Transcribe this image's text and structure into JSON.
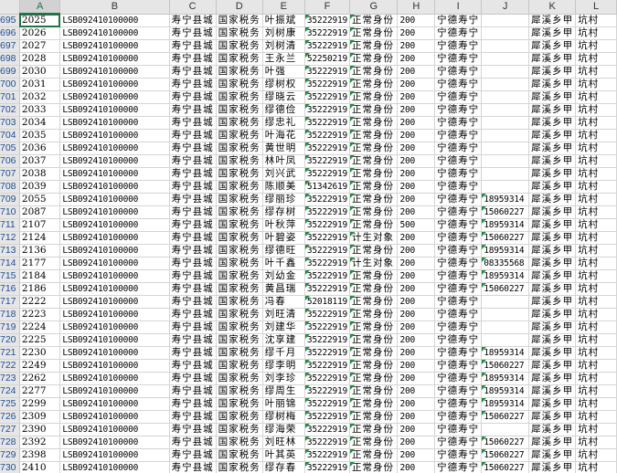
{
  "columns": [
    "A",
    "B",
    "C",
    "D",
    "E",
    "F",
    "G",
    "H",
    "I",
    "J",
    "K",
    "L"
  ],
  "rows": [
    {
      "n": "695",
      "a": "2025",
      "b": "LSB092410100000",
      "c": "寿宁县城",
      "d": "国家税务",
      "e": "叶振斌",
      "f": "35222919",
      "g": "正常身份",
      "h": "200",
      "i": "宁德寿宁",
      "j": "",
      "k": "犀溪乡甲",
      "l": "坑村"
    },
    {
      "n": "696",
      "a": "2026",
      "b": "LSB092410100000",
      "c": "寿宁县城",
      "d": "国家税务",
      "e": "刘树康",
      "f": "35222919",
      "g": "正常身份",
      "h": "200",
      "i": "宁德寿宁",
      "j": "",
      "k": "犀溪乡甲",
      "l": "坑村"
    },
    {
      "n": "697",
      "a": "2027",
      "b": "LSB092410100000",
      "c": "寿宁县城",
      "d": "国家税务",
      "e": "刘树清",
      "f": "35222919",
      "g": "正常身份",
      "h": "200",
      "i": "宁德寿宁",
      "j": "",
      "k": "犀溪乡甲",
      "l": "坑村"
    },
    {
      "n": "698",
      "a": "2028",
      "b": "LSB092410100000",
      "c": "寿宁县城",
      "d": "国家税务",
      "e": "王永兰",
      "f": "52250219",
      "g": "正常身份",
      "h": "200",
      "i": "宁德寿宁",
      "j": "",
      "k": "犀溪乡甲",
      "l": "坑村"
    },
    {
      "n": "699",
      "a": "2030",
      "b": "LSB092410100000",
      "c": "寿宁县城",
      "d": "国家税务",
      "e": "叶强",
      "f": "35222919",
      "g": "正常身份",
      "h": "200",
      "i": "宁德寿宁",
      "j": "",
      "k": "犀溪乡甲",
      "l": "坑村"
    },
    {
      "n": "700",
      "a": "2031",
      "b": "LSB092410100000",
      "c": "寿宁县城",
      "d": "国家税务",
      "e": "缪树权",
      "f": "35222919",
      "g": "正常身份",
      "h": "200",
      "i": "宁德寿宁",
      "j": "",
      "k": "犀溪乡甲",
      "l": "坑村"
    },
    {
      "n": "701",
      "a": "2032",
      "b": "LSB092410100000",
      "c": "寿宁县城",
      "d": "国家税务",
      "e": "缪晓云",
      "f": "35222919",
      "g": "正常身份",
      "h": "200",
      "i": "宁德寿宁",
      "j": "",
      "k": "犀溪乡甲",
      "l": "坑村"
    },
    {
      "n": "702",
      "a": "2033",
      "b": "LSB092410100000",
      "c": "寿宁县城",
      "d": "国家税务",
      "e": "缪德俭",
      "f": "35222919",
      "g": "正常身份",
      "h": "200",
      "i": "宁德寿宁",
      "j": "",
      "k": "犀溪乡甲",
      "l": "坑村"
    },
    {
      "n": "703",
      "a": "2034",
      "b": "LSB092410100000",
      "c": "寿宁县城",
      "d": "国家税务",
      "e": "缪忠礼",
      "f": "35222919",
      "g": "正常身份",
      "h": "200",
      "i": "宁德寿宁",
      "j": "",
      "k": "犀溪乡甲",
      "l": "坑村"
    },
    {
      "n": "704",
      "a": "2035",
      "b": "LSB092410100000",
      "c": "寿宁县城",
      "d": "国家税务",
      "e": "叶海花",
      "f": "35222919",
      "g": "正常身份",
      "h": "200",
      "i": "宁德寿宁",
      "j": "",
      "k": "犀溪乡甲",
      "l": "坑村"
    },
    {
      "n": "705",
      "a": "2036",
      "b": "LSB092410100000",
      "c": "寿宁县城",
      "d": "国家税务",
      "e": "黄世明",
      "f": "35222919",
      "g": "正常身份",
      "h": "200",
      "i": "宁德寿宁",
      "j": "",
      "k": "犀溪乡甲",
      "l": "坑村"
    },
    {
      "n": "706",
      "a": "2037",
      "b": "LSB092410100000",
      "c": "寿宁县城",
      "d": "国家税务",
      "e": "林叶凤",
      "f": "35222919",
      "g": "正常身份",
      "h": "200",
      "i": "宁德寿宁",
      "j": "",
      "k": "犀溪乡甲",
      "l": "坑村"
    },
    {
      "n": "707",
      "a": "2038",
      "b": "LSB092410100000",
      "c": "寿宁县城",
      "d": "国家税务",
      "e": "刘兴武",
      "f": "35222919",
      "g": "正常身份",
      "h": "200",
      "i": "宁德寿宁",
      "j": "",
      "k": "犀溪乡甲",
      "l": "坑村"
    },
    {
      "n": "708",
      "a": "2039",
      "b": "LSB092410100000",
      "c": "寿宁县城",
      "d": "国家税务",
      "e": "陈顺美",
      "f": "51342619",
      "g": "正常身份",
      "h": "200",
      "i": "宁德寿宁",
      "j": "",
      "k": "犀溪乡甲",
      "l": "坑村"
    },
    {
      "n": "709",
      "a": "2055",
      "b": "LSB092410100000",
      "c": "寿宁县城",
      "d": "国家税务",
      "e": "缪丽珍",
      "f": "35222919",
      "g": "正常身份",
      "h": "200",
      "i": "宁德寿宁",
      "j": "18959314",
      "k": "犀溪乡甲",
      "l": "坑村"
    },
    {
      "n": "710",
      "a": "2087",
      "b": "LSB092410100000",
      "c": "寿宁县城",
      "d": "国家税务",
      "e": "缪存树",
      "f": "35222919",
      "g": "正常身份",
      "h": "200",
      "i": "宁德寿宁",
      "j": "15060227",
      "k": "犀溪乡甲",
      "l": "坑村"
    },
    {
      "n": "711",
      "a": "2107",
      "b": "LSB092410100000",
      "c": "寿宁县城",
      "d": "国家税务",
      "e": "叶秋萍",
      "f": "35222919",
      "g": "正常身份",
      "h": "500",
      "i": "宁德寿宁",
      "j": "18959314",
      "k": "犀溪乡甲",
      "l": "坑村"
    },
    {
      "n": "712",
      "a": "2124",
      "b": "LSB092410100000",
      "c": "寿宁县城",
      "d": "国家税务",
      "e": "叶碧姿",
      "f": "35222919",
      "g": "计生对象",
      "h": "200",
      "i": "宁德寿宁",
      "j": "15060227",
      "k": "犀溪乡甲",
      "l": "坑村"
    },
    {
      "n": "713",
      "a": "2136",
      "b": "LSB092410100000",
      "c": "寿宁县城",
      "d": "国家税务",
      "e": "缪德旺",
      "f": "35222919",
      "g": "正常身份",
      "h": "200",
      "i": "宁德寿宁",
      "j": "18959314",
      "k": "犀溪乡甲",
      "l": "坑村"
    },
    {
      "n": "714",
      "a": "2177",
      "b": "LSB092410100000",
      "c": "寿宁县城",
      "d": "国家税务",
      "e": "叶千鑫",
      "f": "35222919",
      "g": "计生对象",
      "h": "200",
      "i": "宁德寿宁",
      "j": "08335568",
      "k": "犀溪乡甲",
      "l": "坑村"
    },
    {
      "n": "715",
      "a": "2184",
      "b": "LSB092410100000",
      "c": "寿宁县城",
      "d": "国家税务",
      "e": "刘幼金",
      "f": "35222919",
      "g": "正常身份",
      "h": "200",
      "i": "宁德寿宁",
      "j": "18959314",
      "k": "犀溪乡甲",
      "l": "坑村"
    },
    {
      "n": "716",
      "a": "2186",
      "b": "LSB092410100000",
      "c": "寿宁县城",
      "d": "国家税务",
      "e": "黄昌瑞",
      "f": "35222919",
      "g": "正常身份",
      "h": "200",
      "i": "宁德寿宁",
      "j": "15060227",
      "k": "犀溪乡甲",
      "l": "坑村"
    },
    {
      "n": "717",
      "a": "2222",
      "b": "LSB092410100000",
      "c": "寿宁县城",
      "d": "国家税务",
      "e": "冯春",
      "f": "52018119",
      "g": "正常身份",
      "h": "200",
      "i": "宁德寿宁",
      "j": "",
      "k": "犀溪乡甲",
      "l": "坑村"
    },
    {
      "n": "718",
      "a": "2223",
      "b": "LSB092410100000",
      "c": "寿宁县城",
      "d": "国家税务",
      "e": "刘旺清",
      "f": "35222919",
      "g": "正常身份",
      "h": "200",
      "i": "宁德寿宁",
      "j": "",
      "k": "犀溪乡甲",
      "l": "坑村"
    },
    {
      "n": "719",
      "a": "2224",
      "b": "LSB092410100000",
      "c": "寿宁县城",
      "d": "国家税务",
      "e": "刘建华",
      "f": "35222919",
      "g": "正常身份",
      "h": "200",
      "i": "宁德寿宁",
      "j": "",
      "k": "犀溪乡甲",
      "l": "坑村"
    },
    {
      "n": "720",
      "a": "2225",
      "b": "LSB092410100000",
      "c": "寿宁县城",
      "d": "国家税务",
      "e": "沈享建",
      "f": "35222919",
      "g": "正常身份",
      "h": "200",
      "i": "宁德寿宁",
      "j": "",
      "k": "犀溪乡甲",
      "l": "坑村"
    },
    {
      "n": "721",
      "a": "2230",
      "b": "LSB092410100000",
      "c": "寿宁县城",
      "d": "国家税务",
      "e": "缪千月",
      "f": "35222919",
      "g": "正常身份",
      "h": "200",
      "i": "宁德寿宁",
      "j": "18959314",
      "k": "犀溪乡甲",
      "l": "坑村"
    },
    {
      "n": "722",
      "a": "2249",
      "b": "LSB092410100000",
      "c": "寿宁县城",
      "d": "国家税务",
      "e": "缪李明",
      "f": "35222919",
      "g": "正常身份",
      "h": "200",
      "i": "宁德寿宁",
      "j": "15060227",
      "k": "犀溪乡甲",
      "l": "坑村"
    },
    {
      "n": "723",
      "a": "2262",
      "b": "LSB092410100000",
      "c": "寿宁县城",
      "d": "国家税务",
      "e": "刘李珍",
      "f": "35222919",
      "g": "正常身份",
      "h": "200",
      "i": "宁德寿宁",
      "j": "18959314",
      "k": "犀溪乡甲",
      "l": "坑村"
    },
    {
      "n": "724",
      "a": "2277",
      "b": "LSB092410100000",
      "c": "寿宁县城",
      "d": "国家税务",
      "e": "缪周生",
      "f": "35222919",
      "g": "正常身份",
      "h": "200",
      "i": "宁德寿宁",
      "j": "18959314",
      "k": "犀溪乡甲",
      "l": "坑村"
    },
    {
      "n": "725",
      "a": "2299",
      "b": "LSB092410100000",
      "c": "寿宁县城",
      "d": "国家税务",
      "e": "叶丽锦",
      "f": "35222919",
      "g": "正常身份",
      "h": "200",
      "i": "宁德寿宁",
      "j": "18959314",
      "k": "犀溪乡甲",
      "l": "坑村"
    },
    {
      "n": "726",
      "a": "2309",
      "b": "LSB092410100000",
      "c": "寿宁县城",
      "d": "国家税务",
      "e": "缪树梅",
      "f": "35222919",
      "g": "正常身份",
      "h": "200",
      "i": "宁德寿宁",
      "j": "15060227",
      "k": "犀溪乡甲",
      "l": "坑村"
    },
    {
      "n": "727",
      "a": "2390",
      "b": "LSB092410100000",
      "c": "寿宁县城",
      "d": "国家税务",
      "e": "缪海荣",
      "f": "35222919",
      "g": "正常身份",
      "h": "200",
      "i": "宁德寿宁",
      "j": "",
      "k": "犀溪乡甲",
      "l": "坑村"
    },
    {
      "n": "728",
      "a": "2392",
      "b": "LSB092410100000",
      "c": "寿宁县城",
      "d": "国家税务",
      "e": "刘旺林",
      "f": "35222919",
      "g": "正常身份",
      "h": "200",
      "i": "宁德寿宁",
      "j": "15060227",
      "k": "犀溪乡甲",
      "l": "坑村"
    },
    {
      "n": "729",
      "a": "2398",
      "b": "LSB092410100000",
      "c": "寿宁县城",
      "d": "国家税务",
      "e": "叶其英",
      "f": "35222919",
      "g": "正常身份",
      "h": "200",
      "i": "宁德寿宁",
      "j": "15060227",
      "k": "犀溪乡甲",
      "l": "坑村"
    },
    {
      "n": "730",
      "a": "2410",
      "b": "LSB092410100000",
      "c": "寿宁县城",
      "d": "国家税务",
      "e": "缪存春",
      "f": "35222919",
      "g": "正常身份",
      "h": "200",
      "i": "宁德寿宁",
      "j": "15060227",
      "k": "犀溪乡甲",
      "l": "坑村"
    }
  ],
  "selected_column": "A",
  "colors": {
    "header_bg": "#e6e6e6",
    "grid": "#d4d4d4",
    "row_number": "#1f4e96",
    "accent": "#217346",
    "error_triangle": "#1e8e3e"
  }
}
